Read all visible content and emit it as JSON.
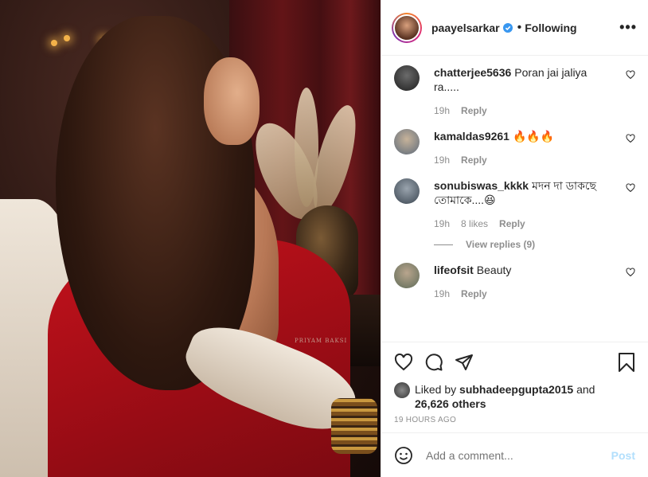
{
  "header": {
    "username": "paayelsarkar",
    "dot": "•",
    "following": "Following",
    "more": "•••"
  },
  "photo": {
    "watermark": "PRIYAM BAKSI"
  },
  "comments": [
    {
      "user": "chatterjee5636",
      "text": "Poran jai jaliya ra.....",
      "time": "19h",
      "likes": "",
      "reply": "Reply"
    },
    {
      "user": "kamaldas9261",
      "text": "🔥🔥🔥",
      "time": "19h",
      "likes": "",
      "reply": "Reply"
    },
    {
      "user": "sonubiswas_kkkk",
      "text": "মদন দা ডাকছে তোমাকে....😆",
      "time": "19h",
      "likes": "8 likes",
      "reply": "Reply"
    },
    {
      "user": "lifeofsit",
      "text": "Beauty",
      "time": "19h",
      "likes": "",
      "reply": "Reply"
    }
  ],
  "view_replies": "View replies (9)",
  "likes": {
    "prefix": "Liked by",
    "user": "subhadeepgupta2015",
    "and": "and",
    "others": "26,626 others"
  },
  "timestamp": "19 HOURS AGO",
  "add_comment": {
    "placeholder": "Add a comment...",
    "post_label": "Post"
  },
  "colors": {
    "verified": "#3897f0",
    "post_button": "#b2dffc",
    "muted": "#8e8e8e"
  }
}
